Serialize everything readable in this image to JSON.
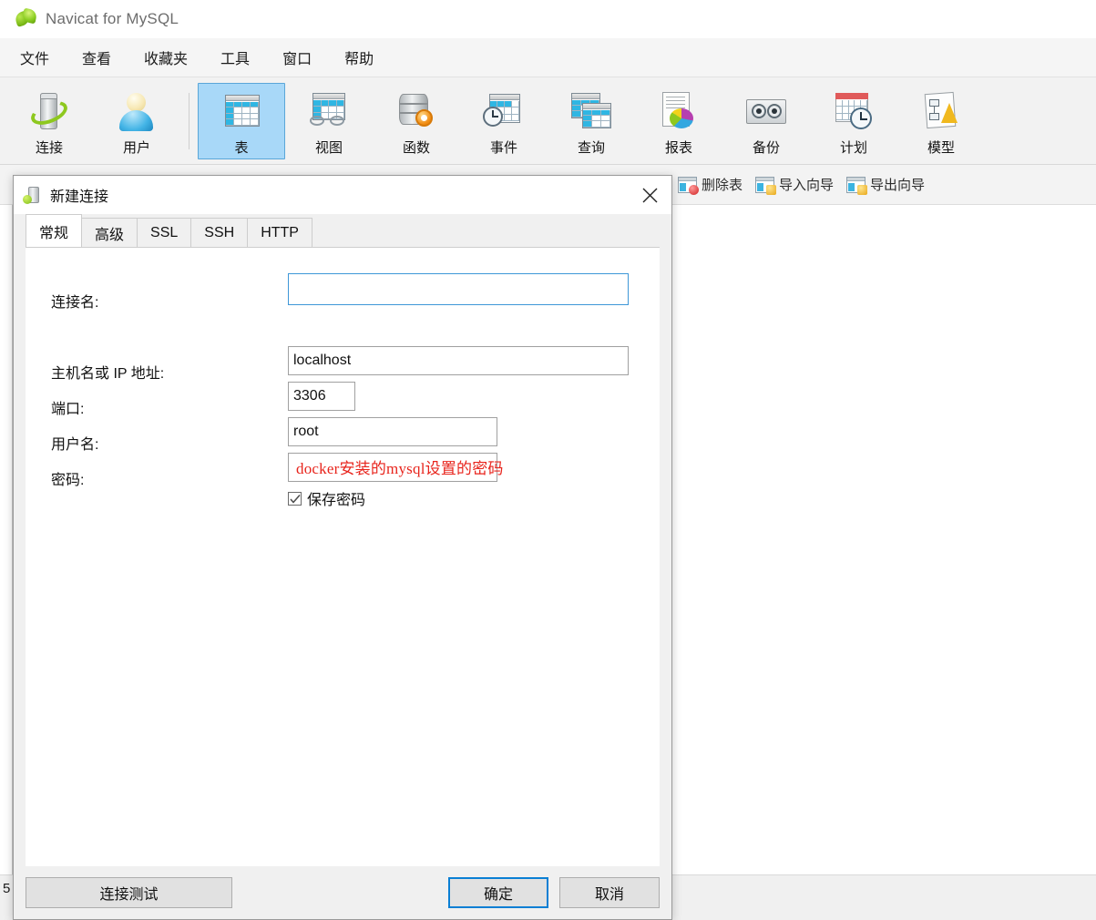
{
  "app": {
    "title": "Navicat for MySQL",
    "logo_icon": "navicat-leaf-logo",
    "menus": [
      {
        "label": "文件",
        "name": "menu-file"
      },
      {
        "label": "查看",
        "name": "menu-view"
      },
      {
        "label": "收藏夹",
        "name": "menu-favorites"
      },
      {
        "label": "工具",
        "name": "menu-tools"
      },
      {
        "label": "窗口",
        "name": "menu-window"
      },
      {
        "label": "帮助",
        "name": "menu-help"
      }
    ],
    "toolbar": [
      {
        "label": "连接",
        "icon": "connection-icon",
        "selected": false
      },
      {
        "label": "用户",
        "icon": "user-icon",
        "selected": false
      },
      {
        "label": "表",
        "icon": "table-icon",
        "selected": true
      },
      {
        "label": "视图",
        "icon": "view-icon",
        "selected": false
      },
      {
        "label": "函数",
        "icon": "function-icon",
        "selected": false
      },
      {
        "label": "事件",
        "icon": "event-icon",
        "selected": false
      },
      {
        "label": "查询",
        "icon": "query-icon",
        "selected": false
      },
      {
        "label": "报表",
        "icon": "report-icon",
        "selected": false
      },
      {
        "label": "备份",
        "icon": "backup-icon",
        "selected": false
      },
      {
        "label": "计划",
        "icon": "schedule-icon",
        "selected": false
      },
      {
        "label": "模型",
        "icon": "model-icon",
        "selected": false
      }
    ],
    "subtoolbar": [
      {
        "label": "删除表",
        "icon": "delete-table-icon",
        "badge": "del"
      },
      {
        "label": "导入向导",
        "icon": "import-wizard-icon",
        "badge": "imp"
      },
      {
        "label": "导出向导",
        "icon": "export-wizard-icon",
        "badge": "exp"
      }
    ],
    "statusbar": {
      "value": "5"
    }
  },
  "dialog": {
    "title": "新建连接",
    "title_icon": "connection-icon",
    "close_icon": "close-icon",
    "tabs": [
      {
        "label": "常规",
        "active": true
      },
      {
        "label": "高级",
        "active": false
      },
      {
        "label": "SSL",
        "active": false
      },
      {
        "label": "SSH",
        "active": false
      },
      {
        "label": "HTTP",
        "active": false
      }
    ],
    "fields": {
      "connection_name": {
        "label": "连接名:",
        "value": "",
        "placeholder": ""
      },
      "host": {
        "label": "主机名或 IP 地址:",
        "value": "localhost"
      },
      "port": {
        "label": "端口:",
        "value": "3306"
      },
      "username": {
        "label": "用户名:",
        "value": "root"
      },
      "password": {
        "label": "密码:",
        "value": ""
      }
    },
    "annotation": {
      "text": "docker安装的mysql设置的密码",
      "color": "#e8241c"
    },
    "save_password": {
      "label": "保存密码",
      "checked": true
    },
    "buttons": {
      "test": "连接测试",
      "ok": "确定",
      "cancel": "取消"
    }
  },
  "colors": {
    "accent_blue": "#0a7fd4",
    "selected_toolbar": "#a8d8f8",
    "focus_border": "#3e97d8",
    "annotation_red": "#e8241c"
  }
}
